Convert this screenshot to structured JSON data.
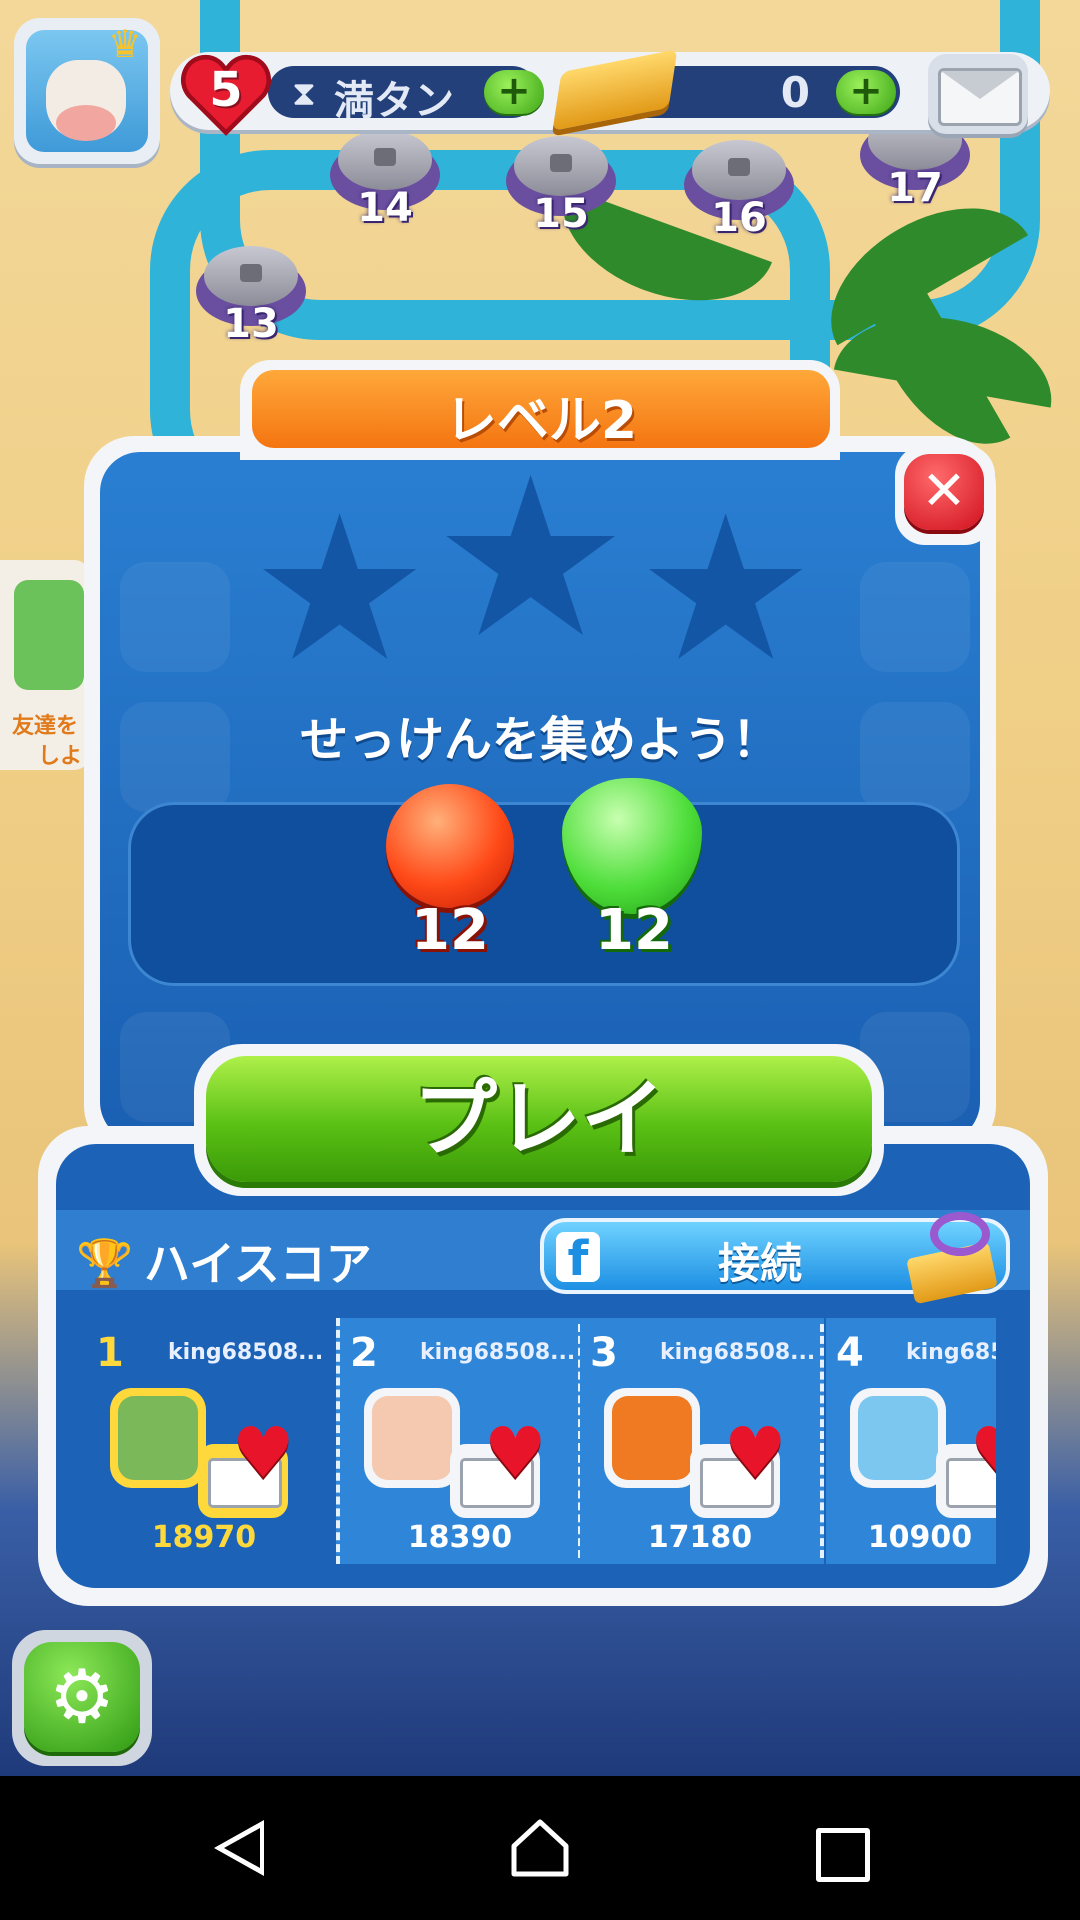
{
  "hud": {
    "lives": "5",
    "lives_status": "満タン",
    "hourglass_symbol": "⧗",
    "plus_symbol": "+",
    "gold": "0"
  },
  "map": {
    "levels": [
      "13",
      "14",
      "15",
      "16",
      "17"
    ]
  },
  "friend_card": {
    "line1": "友達を",
    "line2": "しよ"
  },
  "popup": {
    "title": "レベル2",
    "close_symbol": "✕",
    "goal_text": "せっけんを集めよう！",
    "goals": [
      {
        "item": "red-soap",
        "count": "12"
      },
      {
        "item": "green-soap",
        "count": "12"
      }
    ],
    "play_label": "プレイ"
  },
  "highscore": {
    "title": "ハイスコア",
    "connect_label": "接続",
    "fb_letter": "f",
    "entries": [
      {
        "rank": "1",
        "name": "king68508...",
        "score": "18970"
      },
      {
        "rank": "2",
        "name": "king68508...",
        "score": "18390"
      },
      {
        "rank": "3",
        "name": "king68508...",
        "score": "17180"
      },
      {
        "rank": "4",
        "name": "king685",
        "score": "10900"
      }
    ]
  },
  "icons": {
    "heart": "♥",
    "star": "★",
    "trophy": "🏆",
    "gear": "⚙",
    "crown": "♛"
  },
  "colors": {
    "panel_blue": "#1a5fb2",
    "tab_orange": "#f47512",
    "play_green": "#5ac014",
    "close_red": "#d0101e"
  }
}
